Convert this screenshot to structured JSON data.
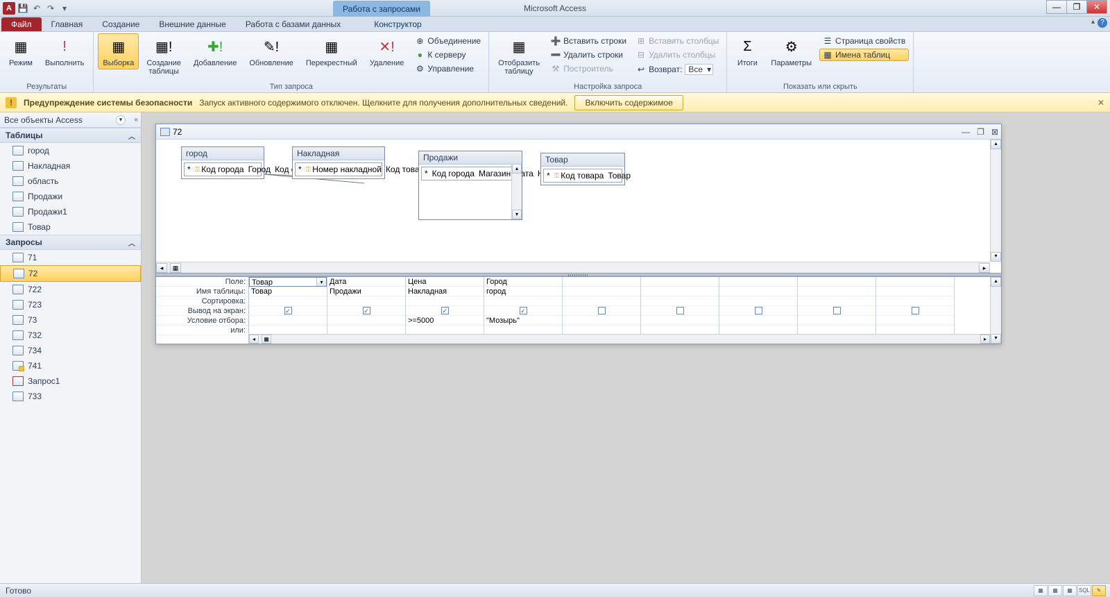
{
  "app_title": "Microsoft Access",
  "context_tab": "Работа с запросами",
  "tabs": {
    "file": "Файл",
    "home": "Главная",
    "create": "Создание",
    "external": "Внешние данные",
    "dbtools": "Работа с базами данных",
    "designer": "Конструктор"
  },
  "ribbon": {
    "results": {
      "label": "Результаты",
      "view": "Режим",
      "run": "Выполнить"
    },
    "qtype": {
      "label": "Тип запроса",
      "select": "Выборка",
      "maketable": "Создание\nтаблицы",
      "append": "Добавление",
      "update": "Обновление",
      "crosstab": "Перекрестный",
      "delete": "Удаление",
      "union": "Объединение",
      "passthrough": "К серверу",
      "datadef": "Управление"
    },
    "setup": {
      "label": "Настройка запроса",
      "showtable": "Отобразить\nтаблицу",
      "insrows": "Вставить строки",
      "delrows": "Удалить строки",
      "builder": "Построитель",
      "inscols": "Вставить столбцы",
      "delcols": "Удалить столбцы",
      "return": "Возврат:",
      "return_val": "Все"
    },
    "showhide": {
      "label": "Показать или скрыть",
      "totals": "Итоги",
      "params": "Параметры",
      "propsheet": "Страница свойств",
      "tablenames": "Имена таблиц"
    }
  },
  "security": {
    "title": "Предупреждение системы безопасности",
    "text": "Запуск активного содержимого отключен. Щелкните для получения дополнительных сведений.",
    "enable": "Включить содержимое"
  },
  "nav": {
    "title": "Все объекты Access",
    "cat_tables": "Таблицы",
    "cat_queries": "Запросы",
    "tables": [
      "город",
      "Накладная",
      "область",
      "Продажи",
      "Продажи1",
      "Товар"
    ],
    "queries": [
      "71",
      "72",
      "722",
      "723",
      "73",
      "732",
      "734",
      "741",
      "Запрос1",
      "733"
    ]
  },
  "query": {
    "title": "72",
    "tables": {
      "t1": {
        "name": "город",
        "fields": [
          "*",
          "Код города",
          "Город",
          "Код области"
        ],
        "keys": [
          1
        ]
      },
      "t2": {
        "name": "Накладная",
        "fields": [
          "*",
          "Номер накладной",
          "Код товара",
          "Цена"
        ],
        "keys": [
          1
        ]
      },
      "t3": {
        "name": "Продажи",
        "fields": [
          "*",
          "Код города",
          "Магазин",
          "Дата",
          "Номер накладной"
        ],
        "keys": []
      },
      "t4": {
        "name": "Товар",
        "fields": [
          "*",
          "Код товара",
          "Товар"
        ],
        "keys": [
          1
        ]
      }
    },
    "grid": {
      "rows": [
        "Поле:",
        "Имя таблицы:",
        "Сортировка:",
        "Вывод на экран:",
        "Условие отбора:",
        "или:"
      ],
      "cols": [
        {
          "field": "Товар",
          "table": "Товар",
          "show": true,
          "crit": "",
          "or": ""
        },
        {
          "field": "Дата",
          "table": "Продажи",
          "show": true,
          "crit": "",
          "or": ""
        },
        {
          "field": "Цена",
          "table": "Накладная",
          "show": true,
          "crit": ">=5000",
          "or": ""
        },
        {
          "field": "Город",
          "table": "город",
          "show": true,
          "crit": "\"Мозырь\"",
          "or": ""
        },
        {
          "field": "",
          "table": "",
          "show": false,
          "crit": "",
          "or": ""
        },
        {
          "field": "",
          "table": "",
          "show": false,
          "crit": "",
          "or": ""
        },
        {
          "field": "",
          "table": "",
          "show": false,
          "crit": "",
          "or": ""
        },
        {
          "field": "",
          "table": "",
          "show": false,
          "crit": "",
          "or": ""
        },
        {
          "field": "",
          "table": "",
          "show": false,
          "crit": "",
          "or": ""
        }
      ]
    }
  },
  "status": "Готово"
}
